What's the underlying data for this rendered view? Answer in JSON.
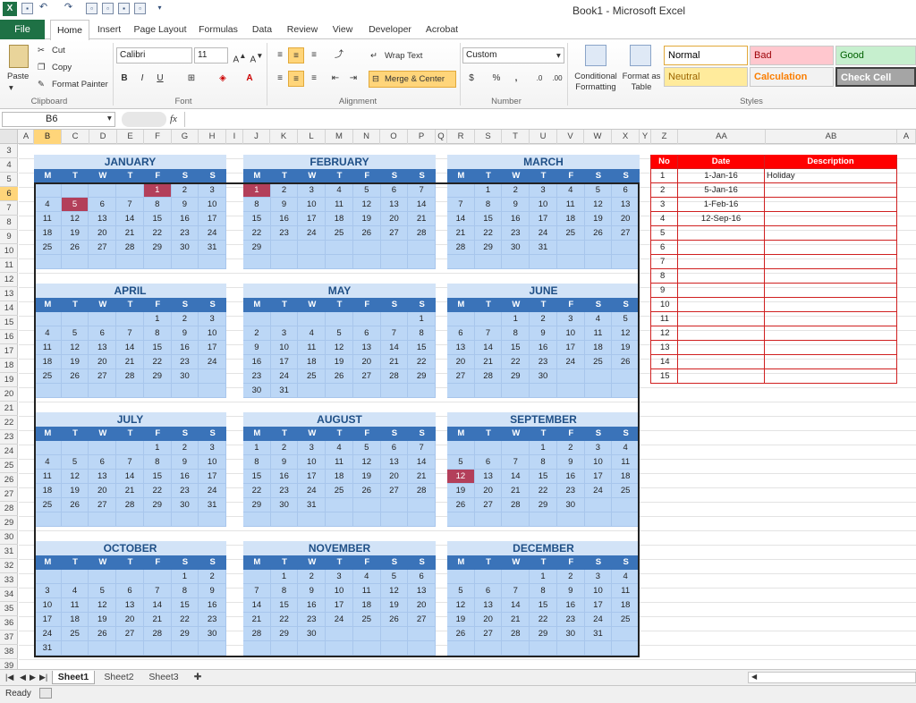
{
  "window": {
    "title": "Book1  -  Microsoft Excel"
  },
  "ribbon_tabs": [
    "File",
    "Home",
    "Insert",
    "Page Layout",
    "Formulas",
    "Data",
    "Review",
    "View",
    "Developer",
    "Acrobat"
  ],
  "clipboard": {
    "paste": "Paste",
    "cut": "Cut",
    "copy": "Copy",
    "format_painter": "Format Painter",
    "group": "Clipboard"
  },
  "font": {
    "name": "Calibri",
    "size": "11",
    "group": "Font"
  },
  "alignment": {
    "wrap_text": "Wrap Text",
    "merge_center": "Merge & Center",
    "group": "Alignment"
  },
  "number": {
    "format": "Custom",
    "group": "Number"
  },
  "styles": {
    "conditional_formatting": "Conditional Formatting",
    "format_as_table": "Format as Table",
    "group": "Styles",
    "cells": [
      {
        "label": "Normal",
        "bg": "#ffffff",
        "fg": "#000000"
      },
      {
        "label": "Bad",
        "bg": "#ffc7ce",
        "fg": "#9c0006"
      },
      {
        "label": "Good",
        "bg": "#c6efce",
        "fg": "#006100"
      },
      {
        "label": "Neutral",
        "bg": "#ffeb9c",
        "fg": "#9c6500"
      },
      {
        "label": "Calculation",
        "bg": "#f2f2f2",
        "fg": "#fa7d00"
      },
      {
        "label": "Check Cell",
        "bg": "#a5a5a5",
        "fg": "#ffffff"
      }
    ]
  },
  "formula_bar": {
    "name_box": "B6",
    "fx": "fx",
    "value": ""
  },
  "columns": [
    "A",
    "B",
    "C",
    "D",
    "E",
    "F",
    "G",
    "H",
    "I",
    "J",
    "K",
    "L",
    "M",
    "N",
    "O",
    "P",
    "Q",
    "R",
    "S",
    "T",
    "U",
    "V",
    "W",
    "X",
    "Y",
    "Z",
    "AA",
    "AB",
    "A"
  ],
  "rows": [
    "3",
    "4",
    "5",
    "6",
    "7",
    "8",
    "9",
    "10",
    "11",
    "12",
    "13",
    "14",
    "15",
    "16",
    "17",
    "18",
    "19",
    "20",
    "21",
    "22",
    "23",
    "24",
    "25",
    "26",
    "27",
    "28",
    "29",
    "30",
    "31",
    "32",
    "33",
    "34",
    "35",
    "36",
    "37",
    "38",
    "39"
  ],
  "weekday_headers": [
    "M",
    "T",
    "W",
    "T",
    "F",
    "S",
    "S"
  ],
  "months": [
    {
      "name": "JANUARY",
      "weeks": [
        [
          "",
          "",
          "",
          "",
          "1",
          "2",
          "3"
        ],
        [
          "4",
          "5",
          "6",
          "7",
          "8",
          "9",
          "10"
        ],
        [
          "11",
          "12",
          "13",
          "14",
          "15",
          "16",
          "17"
        ],
        [
          "18",
          "19",
          "20",
          "21",
          "22",
          "23",
          "24"
        ],
        [
          "25",
          "26",
          "27",
          "28",
          "29",
          "30",
          "31"
        ],
        [
          "",
          "",
          "",
          "",
          "",
          "",
          ""
        ]
      ],
      "holidays": [
        "1",
        "5"
      ]
    },
    {
      "name": "FEBRUARY",
      "weeks": [
        [
          "1",
          "2",
          "3",
          "4",
          "5",
          "6",
          "7"
        ],
        [
          "8",
          "9",
          "10",
          "11",
          "12",
          "13",
          "14"
        ],
        [
          "15",
          "16",
          "17",
          "18",
          "19",
          "20",
          "21"
        ],
        [
          "22",
          "23",
          "24",
          "25",
          "26",
          "27",
          "28"
        ],
        [
          "29",
          "",
          "",
          "",
          "",
          "",
          ""
        ],
        [
          "",
          "",
          "",
          "",
          "",
          "",
          ""
        ]
      ],
      "holidays": [
        "1"
      ]
    },
    {
      "name": "MARCH",
      "weeks": [
        [
          "",
          "1",
          "2",
          "3",
          "4",
          "5",
          "6"
        ],
        [
          "7",
          "8",
          "9",
          "10",
          "11",
          "12",
          "13"
        ],
        [
          "14",
          "15",
          "16",
          "17",
          "18",
          "19",
          "20"
        ],
        [
          "21",
          "22",
          "23",
          "24",
          "25",
          "26",
          "27"
        ],
        [
          "28",
          "29",
          "30",
          "31",
          "",
          "",
          ""
        ],
        [
          "",
          "",
          "",
          "",
          "",
          "",
          ""
        ]
      ],
      "holidays": []
    },
    {
      "name": "APRIL",
      "weeks": [
        [
          "",
          "",
          "",
          "",
          "1",
          "2",
          "3"
        ],
        [
          "4",
          "5",
          "6",
          "7",
          "8",
          "9",
          "10"
        ],
        [
          "11",
          "12",
          "13",
          "14",
          "15",
          "16",
          "17"
        ],
        [
          "18",
          "19",
          "20",
          "21",
          "22",
          "23",
          "24"
        ],
        [
          "25",
          "26",
          "27",
          "28",
          "29",
          "30",
          ""
        ],
        [
          "",
          "",
          "",
          "",
          "",
          "",
          ""
        ]
      ],
      "holidays": []
    },
    {
      "name": "MAY",
      "weeks": [
        [
          "",
          "",
          "",
          "",
          "",
          "",
          "1"
        ],
        [
          "2",
          "3",
          "4",
          "5",
          "6",
          "7",
          "8"
        ],
        [
          "9",
          "10",
          "11",
          "12",
          "13",
          "14",
          "15"
        ],
        [
          "16",
          "17",
          "18",
          "19",
          "20",
          "21",
          "22"
        ],
        [
          "23",
          "24",
          "25",
          "26",
          "27",
          "28",
          "29"
        ],
        [
          "30",
          "31",
          "",
          "",
          "",
          "",
          ""
        ]
      ],
      "holidays": []
    },
    {
      "name": "JUNE",
      "weeks": [
        [
          "",
          "",
          "1",
          "2",
          "3",
          "4",
          "5"
        ],
        [
          "6",
          "7",
          "8",
          "9",
          "10",
          "11",
          "12"
        ],
        [
          "13",
          "14",
          "15",
          "16",
          "17",
          "18",
          "19"
        ],
        [
          "20",
          "21",
          "22",
          "23",
          "24",
          "25",
          "26"
        ],
        [
          "27",
          "28",
          "29",
          "30",
          "",
          "",
          ""
        ],
        [
          "",
          "",
          "",
          "",
          "",
          "",
          ""
        ]
      ],
      "holidays": []
    },
    {
      "name": "JULY",
      "weeks": [
        [
          "",
          "",
          "",
          "",
          "1",
          "2",
          "3"
        ],
        [
          "4",
          "5",
          "6",
          "7",
          "8",
          "9",
          "10"
        ],
        [
          "11",
          "12",
          "13",
          "14",
          "15",
          "16",
          "17"
        ],
        [
          "18",
          "19",
          "20",
          "21",
          "22",
          "23",
          "24"
        ],
        [
          "25",
          "26",
          "27",
          "28",
          "29",
          "30",
          "31"
        ],
        [
          "",
          "",
          "",
          "",
          "",
          "",
          ""
        ]
      ],
      "holidays": []
    },
    {
      "name": "AUGUST",
      "weeks": [
        [
          "1",
          "2",
          "3",
          "4",
          "5",
          "6",
          "7"
        ],
        [
          "8",
          "9",
          "10",
          "11",
          "12",
          "13",
          "14"
        ],
        [
          "15",
          "16",
          "17",
          "18",
          "19",
          "20",
          "21"
        ],
        [
          "22",
          "23",
          "24",
          "25",
          "26",
          "27",
          "28"
        ],
        [
          "29",
          "30",
          "31",
          "",
          "",
          "",
          ""
        ],
        [
          "",
          "",
          "",
          "",
          "",
          "",
          ""
        ]
      ],
      "holidays": []
    },
    {
      "name": "SEPTEMBER",
      "weeks": [
        [
          "",
          "",
          "",
          "1",
          "2",
          "3",
          "4"
        ],
        [
          "5",
          "6",
          "7",
          "8",
          "9",
          "10",
          "11"
        ],
        [
          "12",
          "13",
          "14",
          "15",
          "16",
          "17",
          "18"
        ],
        [
          "19",
          "20",
          "21",
          "22",
          "23",
          "24",
          "25"
        ],
        [
          "26",
          "27",
          "28",
          "29",
          "30",
          "",
          ""
        ],
        [
          "",
          "",
          "",
          "",
          "",
          "",
          ""
        ]
      ],
      "holidays": [
        "12"
      ]
    },
    {
      "name": "OCTOBER",
      "weeks": [
        [
          "",
          "",
          "",
          "",
          "",
          "1",
          "2"
        ],
        [
          "3",
          "4",
          "5",
          "6",
          "7",
          "8",
          "9"
        ],
        [
          "10",
          "11",
          "12",
          "13",
          "14",
          "15",
          "16"
        ],
        [
          "17",
          "18",
          "19",
          "20",
          "21",
          "22",
          "23"
        ],
        [
          "24",
          "25",
          "26",
          "27",
          "28",
          "29",
          "30"
        ],
        [
          "31",
          "",
          "",
          "",
          "",
          "",
          ""
        ]
      ],
      "holidays": []
    },
    {
      "name": "NOVEMBER",
      "weeks": [
        [
          "",
          "1",
          "2",
          "3",
          "4",
          "5",
          "6"
        ],
        [
          "7",
          "8",
          "9",
          "10",
          "11",
          "12",
          "13"
        ],
        [
          "14",
          "15",
          "16",
          "17",
          "18",
          "19",
          "20"
        ],
        [
          "21",
          "22",
          "23",
          "24",
          "25",
          "26",
          "27"
        ],
        [
          "28",
          "29",
          "30",
          "",
          "",
          "",
          ""
        ],
        [
          "",
          "",
          "",
          "",
          "",
          "",
          ""
        ]
      ],
      "holidays": []
    },
    {
      "name": "DECEMBER",
      "weeks": [
        [
          "",
          "",
          "",
          "1",
          "2",
          "3",
          "4"
        ],
        [
          "5",
          "6",
          "7",
          "8",
          "9",
          "10",
          "11"
        ],
        [
          "12",
          "13",
          "14",
          "15",
          "16",
          "17",
          "18"
        ],
        [
          "19",
          "20",
          "21",
          "22",
          "23",
          "24",
          "25"
        ],
        [
          "26",
          "27",
          "28",
          "29",
          "30",
          "31",
          ""
        ],
        [
          "",
          "",
          "",
          "",
          "",
          "",
          ""
        ]
      ],
      "holidays": []
    }
  ],
  "holiday_table": {
    "headers": [
      "No",
      "Date",
      "Description"
    ],
    "rows": [
      {
        "no": "1",
        "date": "1-Jan-16",
        "desc": "Holiday"
      },
      {
        "no": "2",
        "date": "5-Jan-16",
        "desc": ""
      },
      {
        "no": "3",
        "date": "1-Feb-16",
        "desc": ""
      },
      {
        "no": "4",
        "date": "12-Sep-16",
        "desc": ""
      },
      {
        "no": "5",
        "date": "",
        "desc": ""
      },
      {
        "no": "6",
        "date": "",
        "desc": ""
      },
      {
        "no": "7",
        "date": "",
        "desc": ""
      },
      {
        "no": "8",
        "date": "",
        "desc": ""
      },
      {
        "no": "9",
        "date": "",
        "desc": ""
      },
      {
        "no": "10",
        "date": "",
        "desc": ""
      },
      {
        "no": "11",
        "date": "",
        "desc": ""
      },
      {
        "no": "12",
        "date": "",
        "desc": ""
      },
      {
        "no": "13",
        "date": "",
        "desc": ""
      },
      {
        "no": "14",
        "date": "",
        "desc": ""
      },
      {
        "no": "15",
        "date": "",
        "desc": ""
      }
    ]
  },
  "sheets": [
    "Sheet1",
    "Sheet2",
    "Sheet3"
  ],
  "status": {
    "ready": "Ready"
  },
  "colors": {
    "holiday": "#b33f5a",
    "header_blue": "#3a73b9",
    "table_red": "#ff0000",
    "file_green": "#1e7145"
  }
}
